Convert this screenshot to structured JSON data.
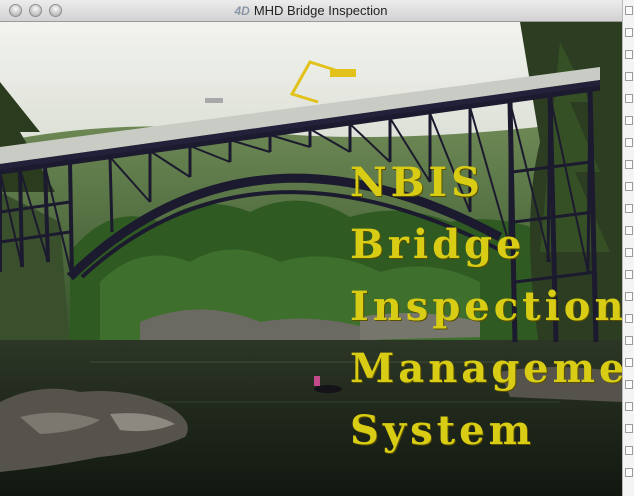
{
  "window": {
    "app_icon": "4D",
    "title": "MHD Bridge Inspection"
  },
  "splash": {
    "lines": [
      "NBIS",
      "Bridge",
      "Inspection",
      "Management",
      "System"
    ],
    "text_color": "#d8cc14"
  },
  "colors": {
    "bridge": "#1c1a2e",
    "water": "#1a2218",
    "forest": "#3f6a2c",
    "sky": "#e9ece6"
  },
  "icons": [
    "close-button",
    "minimize-button",
    "zoom-button"
  ]
}
